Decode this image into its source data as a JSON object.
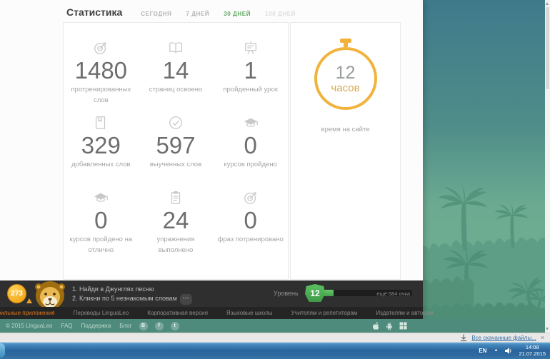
{
  "page": {
    "title": "Статистика",
    "tabs": [
      {
        "label": "СЕГОДНЯ"
      },
      {
        "label": "7 ДНЕЙ"
      },
      {
        "label": "30 ДНЕЙ"
      },
      {
        "label": "100 ДНЕЙ"
      }
    ],
    "stats": [
      {
        "icon": "target-icon",
        "value": "1480",
        "label": "протренированных слов"
      },
      {
        "icon": "open-book-icon",
        "value": "14",
        "label": "страниц освоено"
      },
      {
        "icon": "board-icon",
        "value": "1",
        "label": "пройденный урок"
      },
      {
        "icon": "dictionary-icon",
        "value": "329",
        "label": "добавленных слов"
      },
      {
        "icon": "check-circle-icon",
        "value": "597",
        "label": "выученных слов"
      },
      {
        "icon": "grad-cap-icon",
        "value": "0",
        "label": "курсов пройдено"
      },
      {
        "icon": "grad-cap-icon",
        "value": "0",
        "label": "курсов пройдено на отлично"
      },
      {
        "icon": "clipboard-icon",
        "value": "24",
        "label": "упражнения выполнено"
      },
      {
        "icon": "target-icon",
        "value": "0",
        "label": "фраз потренировано"
      }
    ],
    "time_card": {
      "value": "12",
      "unit": "часов",
      "caption": "время на сайте"
    },
    "quest_bar": {
      "coins": "273",
      "task1": "1. Найди в Джунглях песню",
      "task2": "2. Кликни по 5 незнакомым словам",
      "xp_pill_glyph": "•••",
      "level_label": "Уровень",
      "level": "12",
      "progress_style": "width:13%",
      "remaining": "ещё 584 очка"
    },
    "footer_nav": [
      "Мобильные приложения",
      "Переводы LinguaLeo",
      "Корпоративная версия",
      "Языковые школы",
      "Учителям и репетиторам",
      "Издателям и авторам"
    ],
    "footer_bottom": {
      "copyright": "© 2015 LinguaLeo",
      "links": [
        "FAQ",
        "Поддержка",
        "Блог"
      ],
      "social": [
        {
          "glyph": "B"
        },
        {
          "glyph": "f"
        },
        {
          "glyph": "t"
        }
      ]
    }
  },
  "browser": {
    "download_link": "Все скачанные файлы...",
    "close_glyph": "×"
  },
  "taskbar": {
    "lang": "EN",
    "hidden_icons_glyph": "▲",
    "time": "14:08",
    "date": "21.07.2015"
  },
  "colors": {
    "accent_green": "#5ea763",
    "accent_orange": "#f2b33d",
    "nav_highlight": "#e0761a",
    "footer_teal": "#4e8b7c",
    "dark_bar": "#2f2f2f",
    "taskbar_blue": "#2b659e"
  }
}
